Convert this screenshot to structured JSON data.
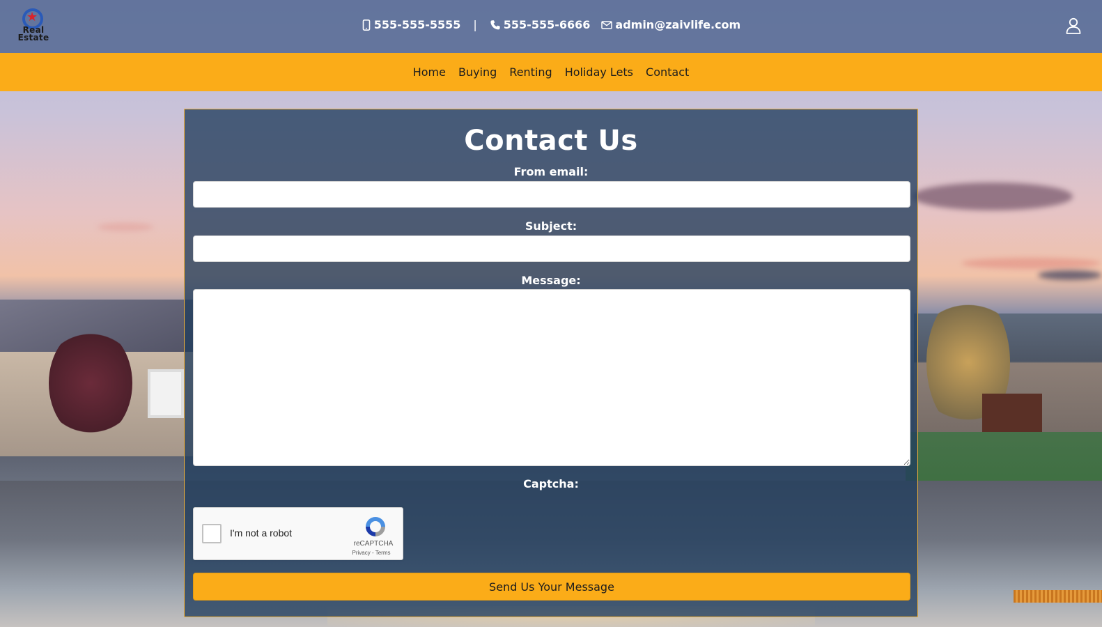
{
  "header": {
    "logo_text_line1": "Real",
    "logo_text_line2": "Estate",
    "mobile_phone": "555-555-5555",
    "separator": "|",
    "phone": "555-555-6666",
    "email": "admin@zaivlife.com",
    "icons": [
      "mobile-phone-icon",
      "phone-icon",
      "envelope-icon",
      "user-icon"
    ]
  },
  "nav": {
    "items": [
      {
        "label": "Home"
      },
      {
        "label": "Buying"
      },
      {
        "label": "Renting"
      },
      {
        "label": "Holiday Lets"
      },
      {
        "label": "Contact"
      }
    ]
  },
  "form": {
    "title": "Contact Us",
    "from_email_label": "From email:",
    "from_email_value": "",
    "subject_label": "Subject:",
    "subject_value": "",
    "message_label": "Message:",
    "message_value": "",
    "captcha_label": "Captcha:",
    "submit_label": "Send Us Your Message"
  },
  "recaptcha": {
    "checkbox_label": "I'm not a robot",
    "brand": "reCAPTCHA",
    "privacy": "Privacy",
    "dash": " - ",
    "terms": "Terms",
    "checked": false
  },
  "colors": {
    "topbar": "#4a608c",
    "navbar": "#fbac18",
    "card": "#213e5e",
    "card_border": "#f3b23a",
    "button": "#fbac18"
  }
}
